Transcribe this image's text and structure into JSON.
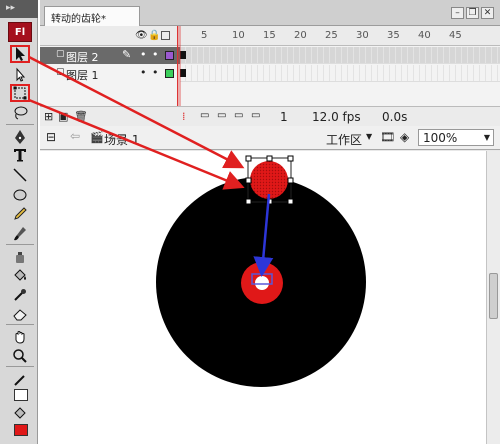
{
  "app": {
    "logo": "Fl",
    "collapse_glyph": "▸▸"
  },
  "document": {
    "tab_title": "转动的齿轮*"
  },
  "timeline": {
    "ruler": [
      "5",
      "10",
      "15",
      "20",
      "25",
      "30",
      "35",
      "40",
      "45"
    ],
    "layers": [
      {
        "name": "图层 2",
        "selected": true,
        "color": "#9b59d0"
      },
      {
        "name": "图层 1",
        "selected": false,
        "color": "#3ccf5c"
      }
    ],
    "footer": {
      "frame": "1",
      "fps": "12.0 fps",
      "time": "0.0s"
    }
  },
  "editbar": {
    "scene": "场景 1",
    "workspace": "工作区",
    "zoom": "100%"
  },
  "colors": {
    "accent": "#e02020",
    "shape_red": "#e01818",
    "stage_circle": "#000000",
    "arrow_blue": "#2d36d8"
  },
  "tools": [
    "selection-tool",
    "subselection-tool",
    "free-transform-tool",
    "lasso-tool",
    "pen-tool",
    "text-tool",
    "line-tool",
    "oval-tool",
    "pencil-tool",
    "brush-tool",
    "ink-bottle-tool",
    "paint-bucket-tool",
    "eyedropper-tool",
    "eraser-tool",
    "hand-tool",
    "zoom-tool",
    "stroke-color",
    "fill-color"
  ]
}
